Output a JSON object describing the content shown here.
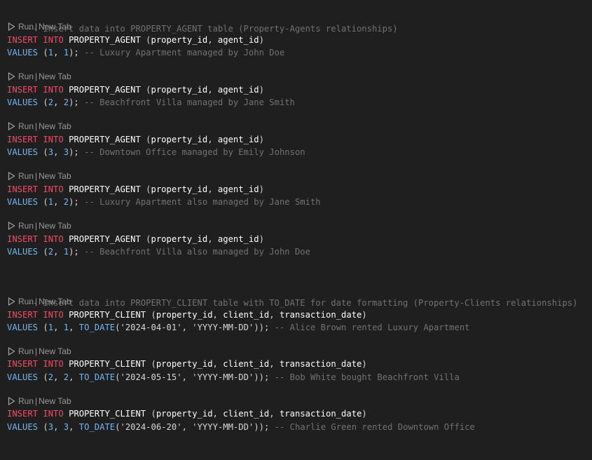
{
  "comments": {
    "agents_header": "-- Insert data into PROPERTY_AGENT table (Property-Agents relationships)",
    "clients_header": "-- Insert data into PROPERTY_CLIENT table with TO_DATE for date formatting (Property-Clients relationships)"
  },
  "codelens": {
    "run": "Run",
    "separator": "|",
    "new_tab": "New Tab"
  },
  "syntax_colors": {
    "keyword": "#f14c69",
    "identifier": "#ffffff",
    "number_function": "#74b6f0",
    "comment": "#727272",
    "background": "#1f1f1f"
  },
  "agent_inserts": [
    {
      "table": "PROPERTY_AGENT",
      "columns": [
        "property_id",
        "agent_id"
      ],
      "values": [
        "1",
        "1"
      ],
      "comment": "-- Luxury Apartment managed by John Doe"
    },
    {
      "table": "PROPERTY_AGENT",
      "columns": [
        "property_id",
        "agent_id"
      ],
      "values": [
        "2",
        "2"
      ],
      "comment": "-- Beachfront Villa managed by Jane Smith"
    },
    {
      "table": "PROPERTY_AGENT",
      "columns": [
        "property_id",
        "agent_id"
      ],
      "values": [
        "3",
        "3"
      ],
      "comment": "-- Downtown Office managed by Emily Johnson"
    },
    {
      "table": "PROPERTY_AGENT",
      "columns": [
        "property_id",
        "agent_id"
      ],
      "values": [
        "1",
        "2"
      ],
      "comment": "-- Luxury Apartment also managed by Jane Smith"
    },
    {
      "table": "PROPERTY_AGENT",
      "columns": [
        "property_id",
        "agent_id"
      ],
      "values": [
        "2",
        "1"
      ],
      "comment": "-- Beachfront Villa also managed by John Doe"
    }
  ],
  "client_inserts": [
    {
      "table": "PROPERTY_CLIENT",
      "columns": [
        "property_id",
        "client_id",
        "transaction_date"
      ],
      "values": [
        "1",
        "1"
      ],
      "date": "'2024-04-01'",
      "format": "'YYYY-MM-DD'",
      "comment": "-- Alice Brown rented Luxury Apartment"
    },
    {
      "table": "PROPERTY_CLIENT",
      "columns": [
        "property_id",
        "client_id",
        "transaction_date"
      ],
      "values": [
        "2",
        "2"
      ],
      "date": "'2024-05-15'",
      "format": "'YYYY-MM-DD'",
      "comment": "-- Bob White bought Beachfront Villa"
    },
    {
      "table": "PROPERTY_CLIENT",
      "columns": [
        "property_id",
        "client_id",
        "transaction_date"
      ],
      "values": [
        "3",
        "3"
      ],
      "date": "'2024-06-20'",
      "format": "'YYYY-MM-DD'",
      "comment": "-- Charlie Green rented Downtown Office"
    }
  ],
  "keywords": {
    "insert": "INSERT",
    "into": "INTO",
    "values": "VALUES",
    "to_date": "TO_DATE"
  }
}
